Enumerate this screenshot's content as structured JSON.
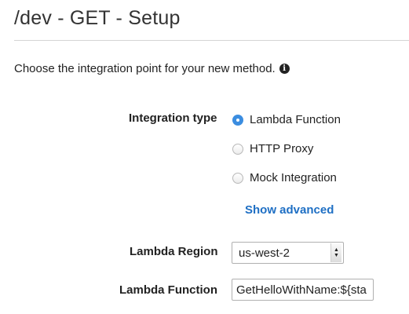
{
  "header": {
    "title": "/dev - GET - Setup"
  },
  "intro": {
    "text": "Choose the integration point for your new method.",
    "info_icon": "info-circle-icon"
  },
  "integration_type": {
    "label": "Integration type",
    "options": [
      {
        "label": "Lambda Function",
        "selected": true
      },
      {
        "label": "HTTP Proxy",
        "selected": false
      },
      {
        "label": "Mock Integration",
        "selected": false
      }
    ],
    "show_advanced_label": "Show advanced"
  },
  "lambda_region": {
    "label": "Lambda Region",
    "value": "us-west-2",
    "arrow_icon": "dropdown-arrow-icon"
  },
  "lambda_function": {
    "label": "Lambda Function",
    "value": "GetHelloWithName:${sta"
  },
  "colors": {
    "accent": "#3b8de0",
    "link": "#1e6fc4",
    "text": "#222222",
    "divider": "#d5d5d5"
  }
}
